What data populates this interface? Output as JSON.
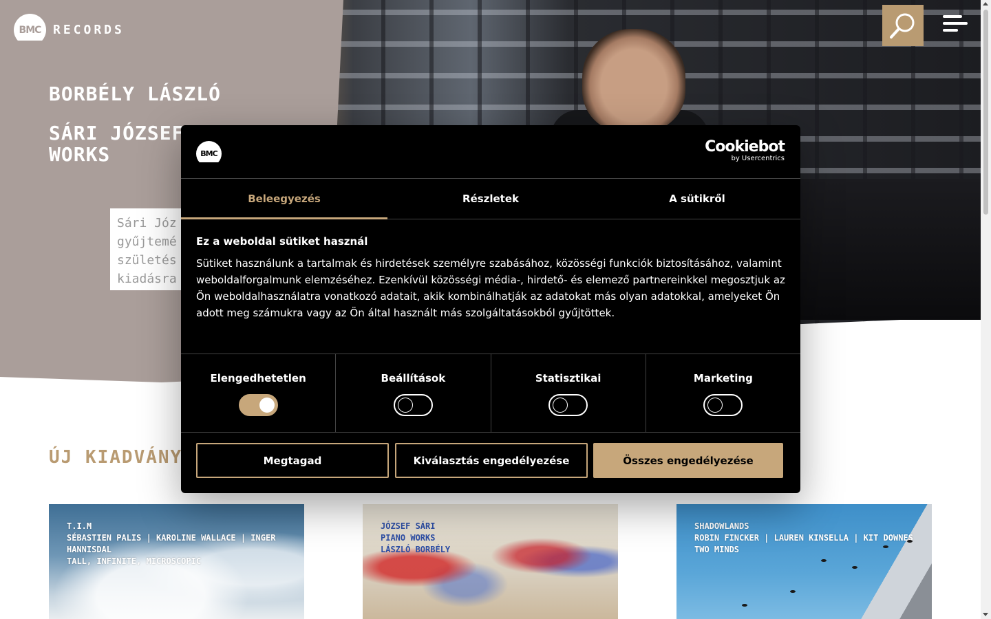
{
  "header": {
    "logo_mark": "BMC",
    "logo_text": "RECORDS",
    "search_icon": "search-icon",
    "menu_icon": "hamburger-menu-icon"
  },
  "hero": {
    "artist": "BORBÉLY LÁSZLÓ",
    "title": "SÁRI JÓZSEF: WORKS",
    "description_lines": [
      "Sári Józ",
      "gyűjtemé",
      "születés",
      "kiadásra"
    ]
  },
  "releases": {
    "title": "ÚJ KIADVÁNYOK",
    "items": [
      {
        "lines": [
          "T.I.M",
          "SÉBASTIEN PALIS | KAROLINE WALLACE | INGER HANNISDAL",
          "TALL, INFINITE, MICROSCOPIC"
        ]
      },
      {
        "lines": [
          "JÓZSEF SÁRI",
          "PIANO WORKS",
          "LÁSZLÓ BORBÉLY"
        ]
      },
      {
        "lines": [
          "SHADOWLANDS",
          "ROBIN FINCKER | LAUREN KINSELLA | KIT DOWNES",
          "TWO MINDS"
        ]
      }
    ]
  },
  "cookie_dialog": {
    "logo_mark": "BMC",
    "brand": "Cookiebot",
    "brand_sub": "by Usercentrics",
    "tabs": [
      "Beleegyezés",
      "Részletek",
      "A sütikről"
    ],
    "active_tab": 0,
    "heading": "Ez a weboldal sütiket használ",
    "body": "Sütiket használunk a tartalmak és hirdetések személyre szabásához, közösségi funkciók biztosításához, valamint weboldalforgalmunk elemzéséhez. Ezenkívül közösségi média-, hirdető- és elemező partnereinkkel megosztjuk az Ön weboldalhasználatra vonatkozó adatait, akik kombinálhatják az adatokat más olyan adatokkal, amelyeket Ön adott meg számukra vagy az Ön által használt más szolgáltatásokból gyűjtöttek.",
    "categories": [
      {
        "label": "Elengedhetetlen",
        "enabled": true
      },
      {
        "label": "Beállítások",
        "enabled": false
      },
      {
        "label": "Statisztikai",
        "enabled": false
      },
      {
        "label": "Marketing",
        "enabled": false
      }
    ],
    "buttons": {
      "deny": "Megtagad",
      "allow_selection": "Kiválasztás engedélyezése",
      "allow_all": "Összes engedélyezése"
    },
    "accent_color": "#c7a77b"
  },
  "colors": {
    "hero_bg": "#aa9e9a",
    "accent": "#b99b72"
  }
}
